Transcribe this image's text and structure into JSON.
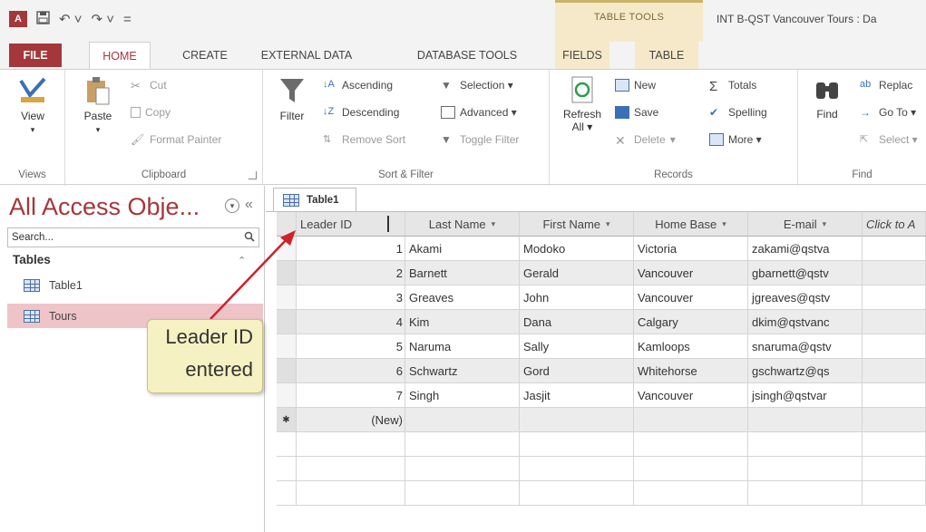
{
  "window": {
    "title": "INT B-QST Vancouver Tours : Da",
    "qat": {
      "app_icon": "A",
      "save_icon": "save-icon",
      "undo": "↶ ˅",
      "redo": "↷ ˅",
      "customize": "="
    },
    "contextual_group": "TABLE TOOLS"
  },
  "tabs": {
    "file": "FILE",
    "home": "HOME",
    "create": "CREATE",
    "external_data": "EXTERNAL DATA",
    "database_tools": "DATABASE TOOLS",
    "fields": "FIELDS",
    "table": "TABLE"
  },
  "ribbon": {
    "views": {
      "label": "Views",
      "view": "View"
    },
    "clipboard": {
      "label": "Clipboard",
      "paste": "Paste",
      "cut": "Cut",
      "copy": "Copy",
      "format_painter": "Format Painter"
    },
    "sort_filter": {
      "label": "Sort & Filter",
      "filter": "Filter",
      "ascending": "Ascending",
      "descending": "Descending",
      "remove_sort": "Remove Sort",
      "selection": "Selection ▾",
      "advanced": "Advanced ▾",
      "toggle_filter": "Toggle Filter"
    },
    "records": {
      "label": "Records",
      "refresh": "Refresh",
      "refresh_all": "All ▾",
      "new": "New",
      "save": "Save",
      "delete": "Delete",
      "delete_arrow": "▾",
      "totals": "Totals",
      "spelling": "Spelling",
      "more": "More ▾"
    },
    "find": {
      "label": "Find",
      "find": "Find",
      "replace": "Replac",
      "goto": "Go To ▾",
      "select": "Select ▾"
    }
  },
  "nav": {
    "title": "All Access Obje...",
    "search_placeholder": "Search...",
    "group": "Tables",
    "items": [
      {
        "label": "Table1"
      },
      {
        "label": "Tours"
      }
    ]
  },
  "callout": {
    "line1": "Leader ID",
    "line2": "entered"
  },
  "datasheet": {
    "tab": "Table1",
    "columns": [
      "Leader ID",
      "Last Name",
      "First Name",
      "Home Base",
      "E-mail",
      "Click to A"
    ],
    "rows": [
      {
        "id": "1",
        "last": "Akami",
        "first": "Modoko",
        "base": "Victoria",
        "email": "zakami@qstva"
      },
      {
        "id": "2",
        "last": "Barnett",
        "first": "Gerald",
        "base": "Vancouver",
        "email": "gbarnett@qstv"
      },
      {
        "id": "3",
        "last": "Greaves",
        "first": "John",
        "base": "Vancouver",
        "email": "jgreaves@qstv"
      },
      {
        "id": "4",
        "last": "Kim",
        "first": "Dana",
        "base": "Calgary",
        "email": "dkim@qstvanc"
      },
      {
        "id": "5",
        "last": "Naruma",
        "first": "Sally",
        "base": "Kamloops",
        "email": "snaruma@qstv"
      },
      {
        "id": "6",
        "last": "Schwartz",
        "first": "Gord",
        "base": "Whitehorse",
        "email": "gschwartz@qs"
      },
      {
        "id": "7",
        "last": "Singh",
        "first": "Jasjit",
        "base": "Vancouver",
        "email": "jsingh@qstvar"
      }
    ],
    "new_marker": "✱",
    "new_label": "(New)"
  },
  "colors": {
    "accent": "#a4373a",
    "context": "#f5e9c9",
    "callout": "#f6f1c2",
    "nav_selected": "#efc4c9"
  }
}
